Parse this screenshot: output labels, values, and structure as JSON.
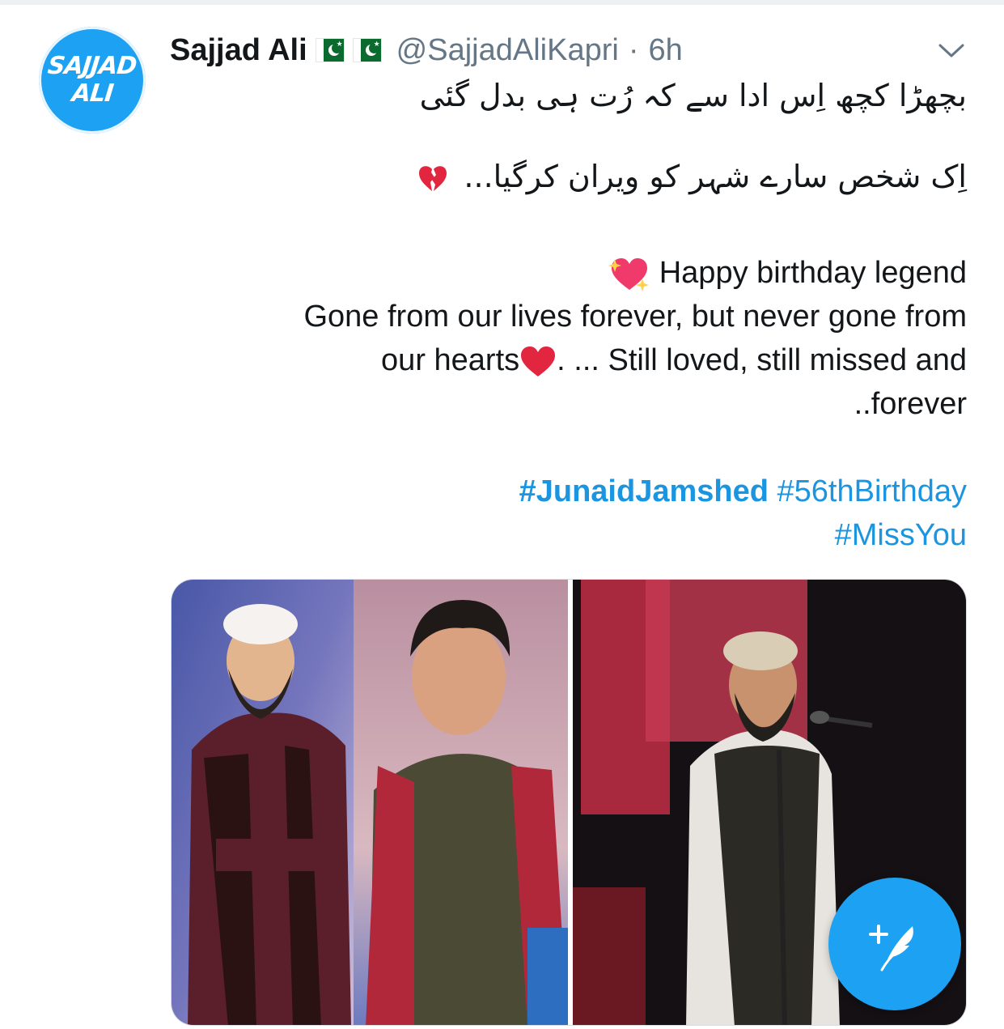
{
  "tweet": {
    "avatar": {
      "line1": "SAJJAD",
      "line2": "ALI"
    },
    "display_name": "Sajjad Ali",
    "handle": "@SajjadAliKapri",
    "separator": "·",
    "time": "6h",
    "urdu_line1": "بچھڑا کچھ اِس ادا سے کہ رُت ہی بدل گئی",
    "urdu_line2": "اِک شخص سارے شہر کو ویران کرگیا...",
    "english_line1": "Happy birthday legend",
    "english_line2": "Gone from our lives forever, but never gone from",
    "english_line3a": "our hearts",
    "english_line3b": ". ... Still loved, still missed and",
    "english_line4": "..forever",
    "hashtags": [
      "#JunaidJamshed",
      "#56thBirthday",
      "#MissYou"
    ]
  },
  "icons": {
    "dropdown": "chevron-down-icon",
    "compose": "compose-tweet-icon",
    "flags": "pakistan-flag-icon"
  },
  "colors": {
    "link": "#1b95e0",
    "brand": "#1da1f2",
    "secondary_text": "#657786"
  }
}
